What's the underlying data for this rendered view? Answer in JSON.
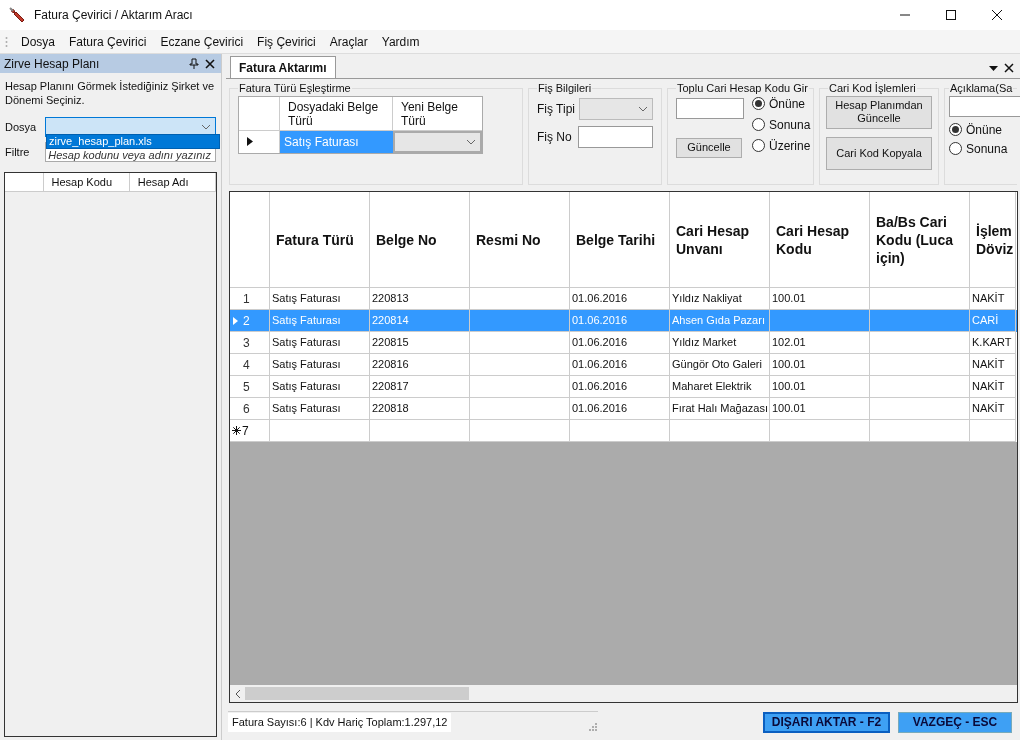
{
  "window": {
    "title": "Fatura Çevirici / Aktarım Aracı"
  },
  "menu": [
    "Dosya",
    "Fatura Çevirici",
    "Eczane Çevirici",
    "Fiş Çevirici",
    "Araçlar",
    "Yardım"
  ],
  "left_panel": {
    "title": "Zirve Hesap Planı",
    "instruction": "Hesap Planını Görmek İstediğiniz Şirket ve Dönemi Seçiniz.",
    "dosya_label": "Dosya",
    "dropdown_option": "zirve_hesap_plan.xls",
    "filtre_label": "Filtre",
    "filtre_placeholder": "Hesap kodunu veya adını yazınız",
    "columns": [
      "Hesap Kodu",
      "Hesap Adı"
    ]
  },
  "tab": {
    "label": "Fatura Aktarımı",
    "selected": true
  },
  "mapping_group": {
    "title": "Fatura Türü Eşleştirme",
    "columns": [
      "Dosyadaki Belge Türü",
      "Yeni Belge Türü"
    ],
    "row": {
      "value": "Satış Faturası",
      "selected": true
    }
  },
  "fis_group": {
    "title": "Fiş Bilgileri",
    "tipi_label": "Fiş Tipi",
    "no_label": "Fiş No"
  },
  "toplu_group": {
    "title": "Toplu Cari Hesap Kodu Gir",
    "button": "Güncelle",
    "options": [
      {
        "label": "Önüne",
        "selected": true
      },
      {
        "label": "Sonuna",
        "selected": false
      },
      {
        "label": "Üzerine",
        "selected": false
      }
    ]
  },
  "cari_group": {
    "title": "Cari Kod İşlemleri",
    "buttons": [
      "Hesap Planımdan Güncelle",
      "Cari Kod Kopyala"
    ]
  },
  "aciklama_group": {
    "title": "Açıklama(Sa",
    "options": [
      {
        "label": "Önüne",
        "selected": true
      },
      {
        "label": "Sonuna",
        "selected": false
      }
    ]
  },
  "grid": {
    "columns": [
      "Fatura Türü",
      "Belge No",
      "Resmi No",
      "Belge Tarihi",
      "Cari Hesap Unvanı",
      "Cari Hesap Kodu",
      "Ba/Bs Cari Kodu (Luca için)",
      "İşlem Döviz"
    ],
    "rows": [
      {
        "number": "1",
        "selected": false,
        "fatura_turu": "Satış Faturası",
        "belge_no": "220813",
        "belge_tarihi": "01.06.2016",
        "unvan": "Yıldız Nakliyat",
        "hesap_kodu": "100.01",
        "doviz": "NAKİT"
      },
      {
        "number": "2",
        "selected": true,
        "fatura_turu": "Satış Faturası",
        "belge_no": "220814",
        "belge_tarihi": "01.06.2016",
        "unvan": "Ahsen Gıda Pazarı",
        "doviz": "CARİ"
      },
      {
        "number": "3",
        "selected": false,
        "fatura_turu": "Satış Faturası",
        "belge_no": "220815",
        "belge_tarihi": "01.06.2016",
        "unvan": "Yıldız Market",
        "hesap_kodu": "102.01",
        "doviz": "K.KART"
      },
      {
        "number": "4",
        "selected": false,
        "fatura_turu": "Satış Faturası",
        "belge_no": "220816",
        "belge_tarihi": "01.06.2016",
        "unvan": "Güngör Oto Galeri",
        "hesap_kodu": "100.01",
        "doviz": "NAKİT"
      },
      {
        "number": "5",
        "selected": false,
        "fatura_turu": "Satış Faturası",
        "belge_no": "220817",
        "belge_tarihi": "01.06.2016",
        "unvan": "Maharet Elektrik",
        "hesap_kodu": "100.01",
        "doviz": "NAKİT"
      },
      {
        "number": "6",
        "selected": false,
        "fatura_turu": "Satış Faturası",
        "belge_no": "220818",
        "belge_tarihi": "01.06.2016",
        "unvan": "Fırat Halı Mağazası",
        "hesap_kodu": "100.01",
        "doviz": "NAKİT"
      }
    ],
    "new_row": "7"
  },
  "status": "Fatura Sayısı:6 | Kdv Hariç Toplam:1.297,12",
  "buttons": [
    "DIŞARI AKTAR - F2",
    "VAZGEÇ - ESC"
  ]
}
